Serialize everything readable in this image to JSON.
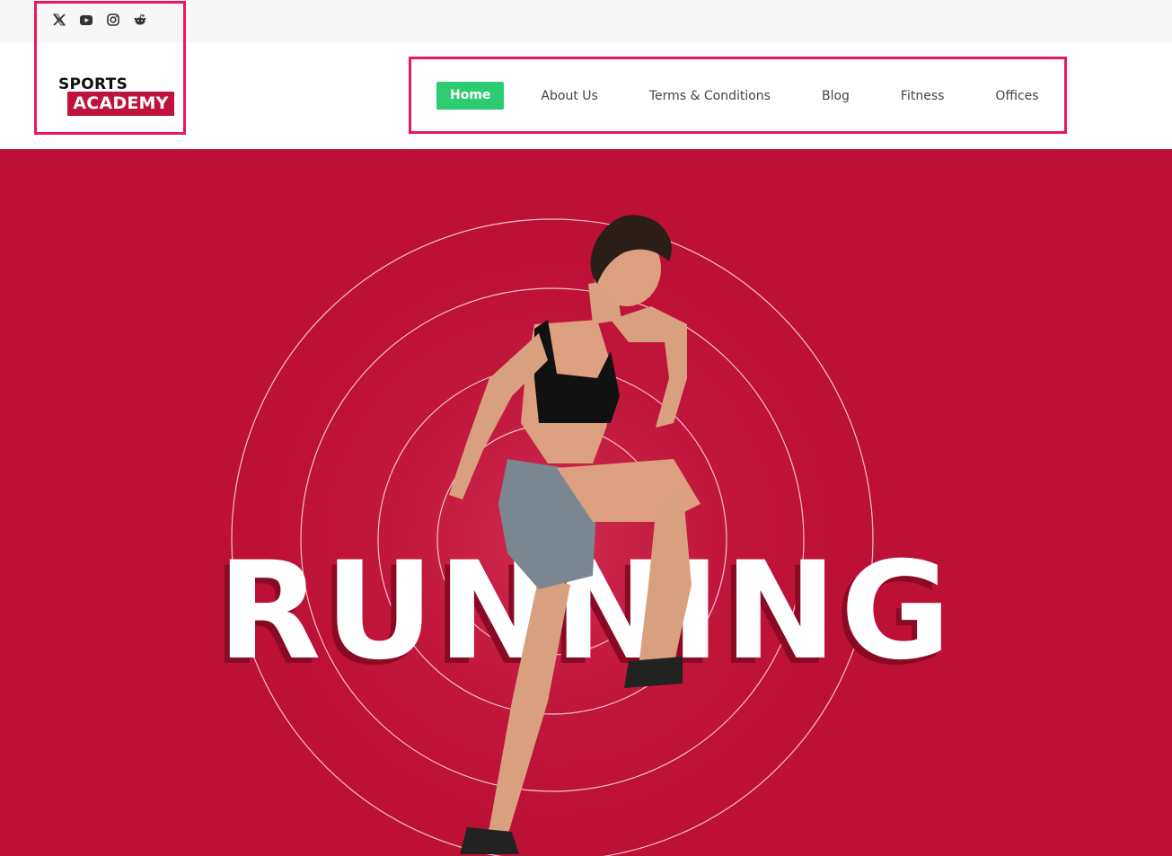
{
  "social": [
    {
      "icon": "x-twitter-icon"
    },
    {
      "icon": "youtube-icon"
    },
    {
      "icon": "instagram-icon"
    },
    {
      "icon": "reddit-icon"
    }
  ],
  "logo": {
    "line1": "SPORTS",
    "line2": "ACADEMY"
  },
  "nav": {
    "home": "Home",
    "about": "About Us",
    "terms": "Terms & Conditions",
    "blog": "Blog",
    "fitness": "Fitness",
    "offices": "Offices"
  },
  "hero": {
    "word": "RUNNING"
  },
  "colors": {
    "brand_red": "#c0123a",
    "hero_bg": "#bd1036",
    "active_nav": "#2ecc71",
    "highlight": "#e8185a"
  }
}
